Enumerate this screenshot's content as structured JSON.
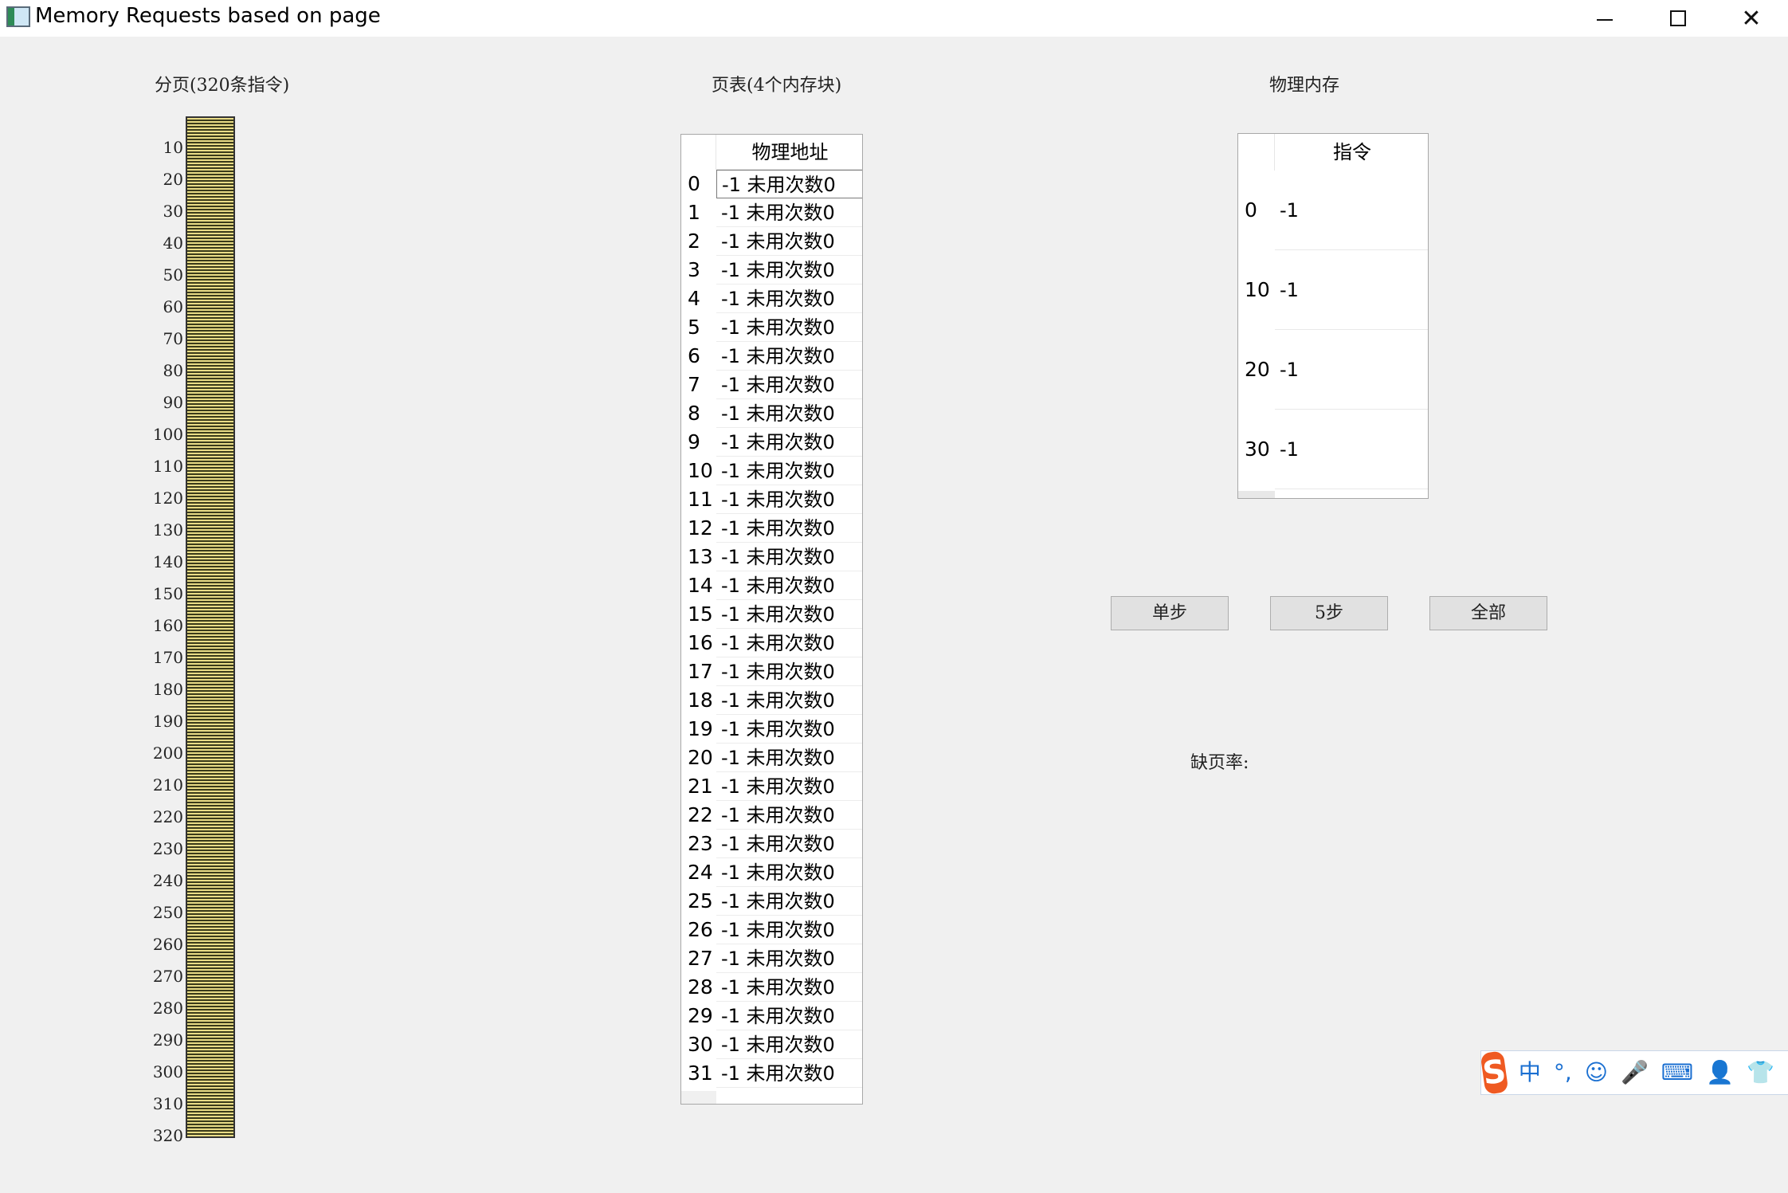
{
  "window": {
    "title": "Memory Requests based on page"
  },
  "paging": {
    "label": "分页(320条指令)",
    "ticks": [
      "10",
      "20",
      "30",
      "40",
      "50",
      "60",
      "70",
      "80",
      "90",
      "100",
      "110",
      "120",
      "130",
      "140",
      "150",
      "160",
      "170",
      "180",
      "190",
      "200",
      "210",
      "220",
      "230",
      "240",
      "250",
      "260",
      "270",
      "280",
      "290",
      "300",
      "310",
      "320"
    ]
  },
  "page_table": {
    "label": "页表(4个内存块)",
    "header": "物理地址",
    "rows": [
      {
        "num": "0",
        "value": "-1 未用次数0"
      },
      {
        "num": "1",
        "value": "-1 未用次数0"
      },
      {
        "num": "2",
        "value": "-1 未用次数0"
      },
      {
        "num": "3",
        "value": "-1 未用次数0"
      },
      {
        "num": "4",
        "value": "-1 未用次数0"
      },
      {
        "num": "5",
        "value": "-1 未用次数0"
      },
      {
        "num": "6",
        "value": "-1 未用次数0"
      },
      {
        "num": "7",
        "value": "-1 未用次数0"
      },
      {
        "num": "8",
        "value": "-1 未用次数0"
      },
      {
        "num": "9",
        "value": "-1 未用次数0"
      },
      {
        "num": "10",
        "value": "-1 未用次数0"
      },
      {
        "num": "11",
        "value": "-1 未用次数0"
      },
      {
        "num": "12",
        "value": "-1 未用次数0"
      },
      {
        "num": "13",
        "value": "-1 未用次数0"
      },
      {
        "num": "14",
        "value": "-1 未用次数0"
      },
      {
        "num": "15",
        "value": "-1 未用次数0"
      },
      {
        "num": "16",
        "value": "-1 未用次数0"
      },
      {
        "num": "17",
        "value": "-1 未用次数0"
      },
      {
        "num": "18",
        "value": "-1 未用次数0"
      },
      {
        "num": "19",
        "value": "-1 未用次数0"
      },
      {
        "num": "20",
        "value": "-1 未用次数0"
      },
      {
        "num": "21",
        "value": "-1 未用次数0"
      },
      {
        "num": "22",
        "value": "-1 未用次数0"
      },
      {
        "num": "23",
        "value": "-1 未用次数0"
      },
      {
        "num": "24",
        "value": "-1 未用次数0"
      },
      {
        "num": "25",
        "value": "-1 未用次数0"
      },
      {
        "num": "26",
        "value": "-1 未用次数0"
      },
      {
        "num": "27",
        "value": "-1 未用次数0"
      },
      {
        "num": "28",
        "value": "-1 未用次数0"
      },
      {
        "num": "29",
        "value": "-1 未用次数0"
      },
      {
        "num": "30",
        "value": "-1 未用次数0"
      },
      {
        "num": "31",
        "value": "-1 未用次数0"
      }
    ]
  },
  "memory": {
    "label": "物理内存",
    "header": "指令",
    "rows": [
      {
        "num": "0",
        "value": "-1"
      },
      {
        "num": "10",
        "value": "-1"
      },
      {
        "num": "20",
        "value": "-1"
      },
      {
        "num": "30",
        "value": "-1"
      }
    ]
  },
  "buttons": {
    "single_step": "单步",
    "five_steps": "5步",
    "all": "全部"
  },
  "fault_rate": {
    "label": "缺页率:"
  },
  "ime": {
    "logo": "S",
    "items": [
      "中",
      "°,",
      "☺",
      "🎤",
      "⌨",
      "👤",
      "👕",
      "▦"
    ]
  },
  "colors": {
    "window_bg": "#f0f0f0",
    "paging_bar_fill": "#e9dc86",
    "ime_accent": "#ef5a22",
    "ime_icon": "#1a6fd1"
  }
}
